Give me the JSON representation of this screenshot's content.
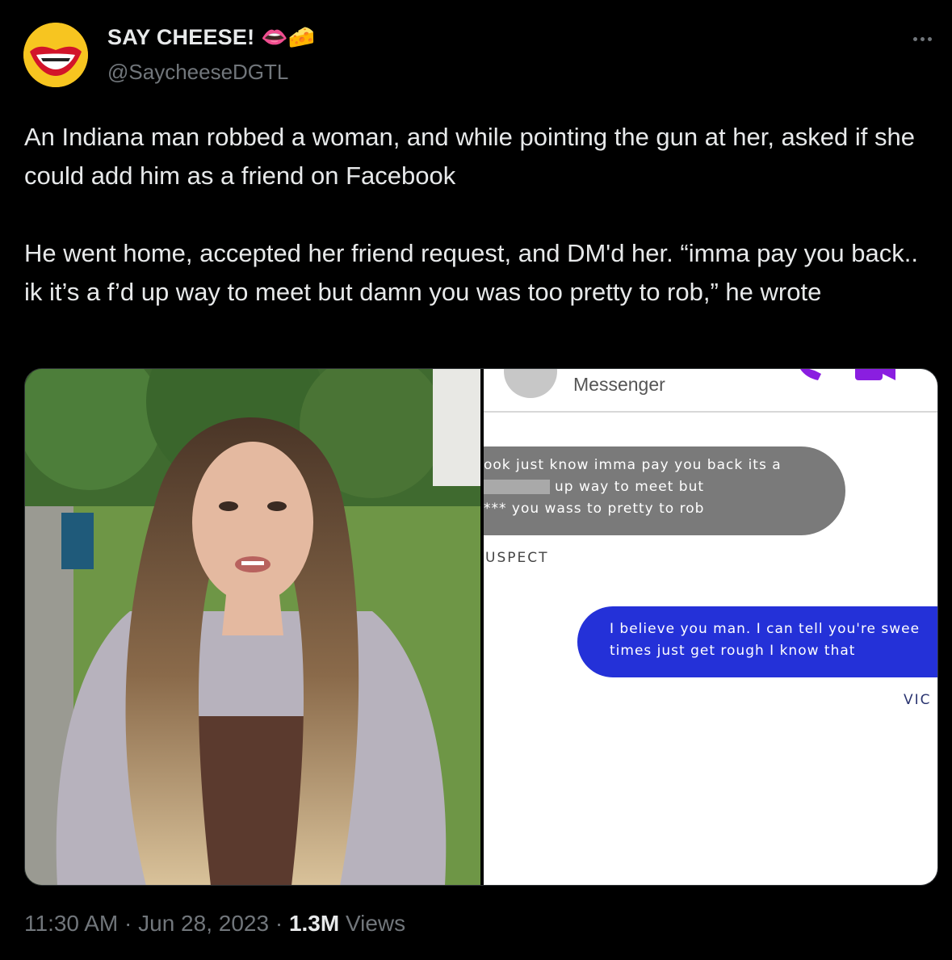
{
  "author": {
    "display_name": "SAY CHEESE! 👄🧀",
    "handle": "@SaycheeseDGTL",
    "avatar_text": "SAY CHEESE"
  },
  "tweet": {
    "paragraph1": "An Indiana man robbed a woman, and while pointing the gun at her, asked if she could add him as a friend on Facebook",
    "paragraph2": "He went home, accepted her friend request, and DM'd her. “imma pay you back.. ik it’s a f’d up way to meet but damn you was too pretty to rob,” he wrote"
  },
  "media": {
    "messenger_title": "Messenger",
    "grey_bubble": {
      "line1": "ook just know imma pay you back its a",
      "line2": "up way to meet but",
      "line3_prefix": "***",
      "line3": "you wass to pretty to rob"
    },
    "suspect_label": "USPECT",
    "blue_bubble": {
      "line1": "I believe you man. I can tell you're swee",
      "line2": "times just get rough I know that"
    },
    "victim_label": "VIC"
  },
  "meta": {
    "time": "11:30 AM",
    "separator": "·",
    "date": "Jun 28, 2023",
    "views_count": "1.3M",
    "views_label": "Views"
  },
  "colors": {
    "background": "#000000",
    "text": "#e7e9ea",
    "muted": "#71767b",
    "messenger_blue": "#2431d8"
  }
}
